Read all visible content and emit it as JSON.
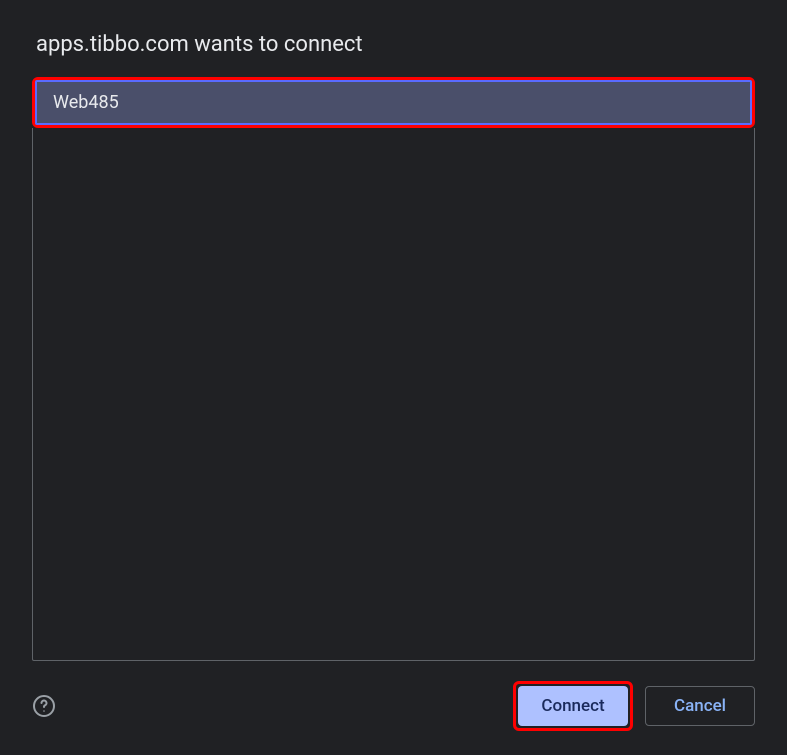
{
  "dialog": {
    "title": "apps.tibbo.com wants to connect"
  },
  "devices": [
    {
      "name": "Web485",
      "selected": true
    }
  ],
  "footer": {
    "connect_label": "Connect",
    "cancel_label": "Cancel"
  }
}
